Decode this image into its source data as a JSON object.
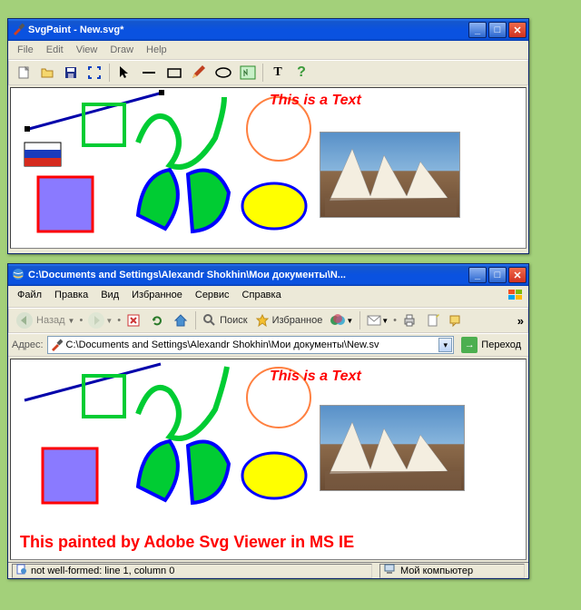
{
  "svgpaint": {
    "title": "SvgPaint - New.svg*",
    "menu": {
      "file": "File",
      "edit": "Edit",
      "view": "View",
      "draw": "Draw",
      "help": "Help"
    },
    "canvas_text": "This is a Text"
  },
  "ie": {
    "title": "C:\\Documents and Settings\\Alexandr Shokhin\\Мои документы\\N...",
    "menu": {
      "file": "Файл",
      "edit": "Правка",
      "view": "Вид",
      "fav": "Избранное",
      "tools": "Сервис",
      "help": "Справка"
    },
    "toolbar": {
      "back": "Назад",
      "search": "Поиск",
      "fav": "Избранное"
    },
    "address_label": "Адрес:",
    "address_value": "C:\\Documents and Settings\\Alexandr Shokhin\\Мои документы\\New.sv",
    "go_label": "Переход",
    "canvas_text": "This is a Text",
    "caption": "This painted by Adobe Svg Viewer in  MS IE",
    "status_left": "not well-formed: line 1, column 0",
    "status_right": "Мой компьютер"
  },
  "win_controls": {
    "min": "_",
    "max": "□",
    "close": "✕"
  },
  "colors": {
    "titlebar": "#0a52e0",
    "red": "#ff0000",
    "green": "#00cc33",
    "blue": "#0000ff",
    "yellow": "#ffff00",
    "purple": "#8a7aff",
    "orange": "#ff8040"
  }
}
